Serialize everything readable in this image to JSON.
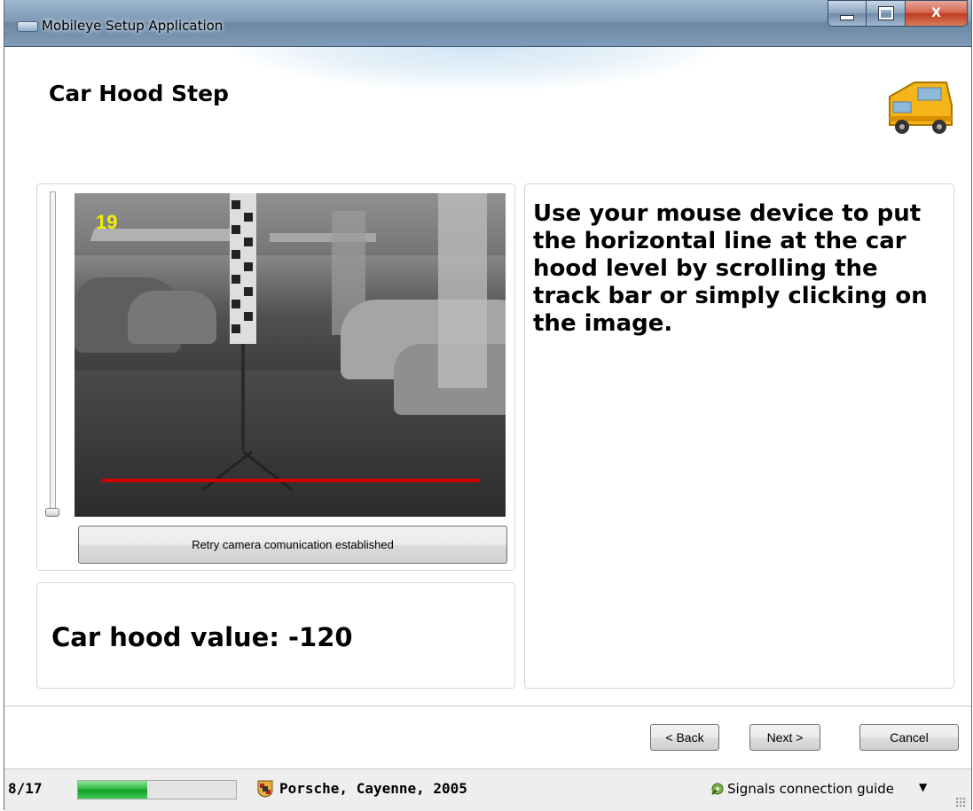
{
  "window": {
    "title": "Mobileye Setup Application",
    "minimize_label": "minimize",
    "maximize_label": "maximize",
    "close_label": "X"
  },
  "header": {
    "title": "Car Hood Step",
    "icon": "camper-van-icon"
  },
  "camera": {
    "frame_number": "19",
    "retry_button_label": "Retry camera comunication established",
    "trackbar_icon": "vertical-trackbar",
    "hood_line_color": "#d10000"
  },
  "value_panel": {
    "text": "Car hood value: -120"
  },
  "instructions": {
    "text": "Use your mouse device to put the horizontal line at the car hood level by scrolling the track bar or simply clicking on the image."
  },
  "buttons": {
    "back": "< Back",
    "next": "Next >",
    "cancel": "Cancel"
  },
  "status": {
    "step": "8/17",
    "progress_fraction": 0.44,
    "progress_color": "#25b43a",
    "vehicle": "Porsche, Cayenne, 2005",
    "vehicle_icon": "porsche-crest-icon",
    "guide_label": "Signals connection guide",
    "guide_icon": "signal-guide-icon",
    "guide_arrow": "▼"
  }
}
